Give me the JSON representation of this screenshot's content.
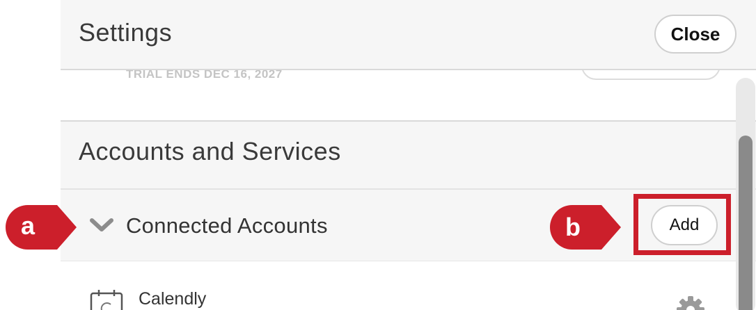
{
  "header": {
    "title": "Settings",
    "close_label": "Close"
  },
  "trial": {
    "text": "TRIAL ENDS DEC 16, 2027"
  },
  "section": {
    "title": "Accounts and Services"
  },
  "connected_accounts": {
    "label": "Connected Accounts",
    "add_label": "Add"
  },
  "items": [
    {
      "name": "Calendly"
    }
  ],
  "annotations": {
    "a": "a",
    "b": "b"
  },
  "colors": {
    "annotation": "#cc1f2b",
    "panel_bg": "#f6f6f6"
  }
}
